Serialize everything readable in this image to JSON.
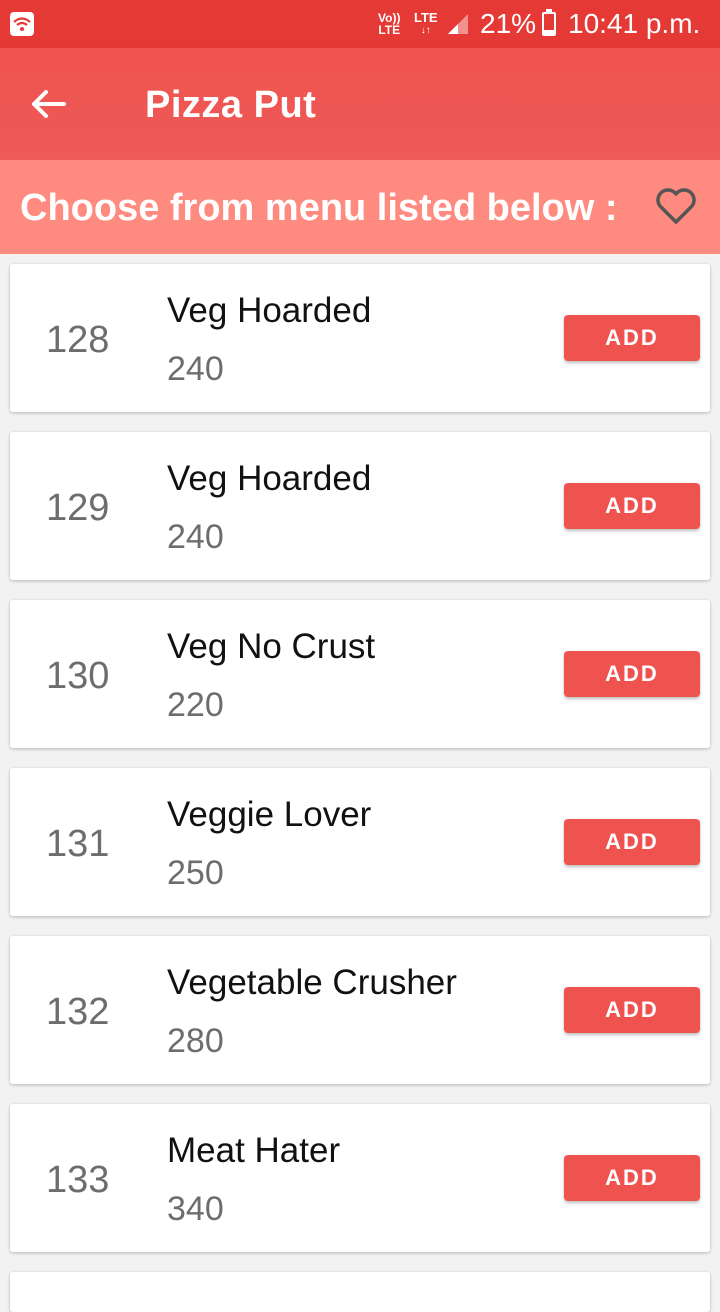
{
  "status_bar": {
    "volte_top": "Vo))",
    "volte_bottom": "LTE",
    "lte_label": "LTE",
    "lte_arrows": "↓↑",
    "battery_level": 0.21,
    "battery": "21%",
    "time": "10:41 p.m."
  },
  "app_bar": {
    "title": "Pizza Put",
    "back_icon": "arrow-back-icon"
  },
  "sub_header": {
    "text": "Choose from menu listed below :",
    "favorite_icon": "heart-outline-icon"
  },
  "menu": [
    {
      "id": "128",
      "name": "Veg Hoarded",
      "price": "240",
      "add_label": "ADD"
    },
    {
      "id": "129",
      "name": "Veg Hoarded",
      "price": "240",
      "add_label": "ADD"
    },
    {
      "id": "130",
      "name": "Veg No Crust",
      "price": "220",
      "add_label": "ADD"
    },
    {
      "id": "131",
      "name": "Veggie Lover",
      "price": "250",
      "add_label": "ADD"
    },
    {
      "id": "132",
      "name": "Vegetable Crusher",
      "price": "280",
      "add_label": "ADD"
    },
    {
      "id": "133",
      "name": "Meat Hater",
      "price": "340",
      "add_label": "ADD"
    }
  ],
  "colors": {
    "primary": "#ef5350",
    "status_bar": "#e53935",
    "sub_header": "#ff8a80"
  }
}
